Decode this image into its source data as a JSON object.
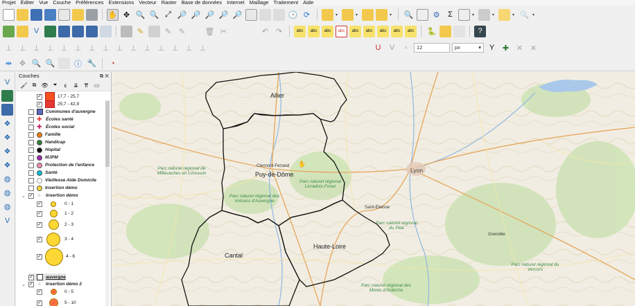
{
  "menu": [
    "Projet",
    "Éditer",
    "Vue",
    "Couche",
    "Préférences",
    "Extensions",
    "Vecteur",
    "Raster",
    "Base de données",
    "Internet",
    "Maillage",
    "Traitement",
    "Aide"
  ],
  "toolbar": {
    "size_value": "12",
    "unit_value": "px"
  },
  "panel": {
    "title": "Couches",
    "controls": "⧉ ✕"
  },
  "layers": [
    {
      "label": "17,7 - 25,7",
      "checked": true,
      "indent": 1,
      "symbol": "square",
      "color": "#f4511e"
    },
    {
      "label": "25,7 - 42,9",
      "checked": true,
      "indent": 1,
      "symbol": "square",
      "color": "#e53935"
    },
    {
      "label": "Communes d'auvergne",
      "checked": false,
      "indent": 0,
      "symbol": "grid",
      "color": "#5c6bc0"
    },
    {
      "label": "Écoles santé",
      "checked": false,
      "indent": 0,
      "symbol": "cross",
      "color": "#e53935"
    },
    {
      "label": "Écoles social",
      "checked": false,
      "indent": 0,
      "symbol": "cross",
      "color": "#c2185b"
    },
    {
      "label": "Famille",
      "checked": false,
      "indent": 0,
      "symbol": "dot",
      "color": "#f57c00"
    },
    {
      "label": "Handicap",
      "checked": false,
      "indent": 0,
      "symbol": "dot",
      "color": "#2e7d32"
    },
    {
      "label": "Hopital",
      "checked": false,
      "indent": 0,
      "symbol": "dot",
      "color": "#111111"
    },
    {
      "label": "MJPM",
      "checked": false,
      "indent": 0,
      "symbol": "dot",
      "color": "#9c27b0"
    },
    {
      "label": "Protection de l'enfance",
      "checked": false,
      "indent": 0,
      "symbol": "dot",
      "color": "#f48fb1"
    },
    {
      "label": "Santé",
      "checked": false,
      "indent": 0,
      "symbol": "dot",
      "color": "#00bcd4"
    },
    {
      "label": "Vieillesse Aide Domicile",
      "checked": false,
      "indent": 0,
      "symbol": "ring",
      "color": "#9e9e9e"
    },
    {
      "label": "Insertion démo",
      "checked": false,
      "indent": 0,
      "symbol": "dot",
      "color": "#fdd835"
    },
    {
      "label": "Insertion démo",
      "checked": true,
      "indent": 0,
      "symbol": "group",
      "color": "#555555"
    },
    {
      "label": "0 - 1",
      "checked": true,
      "indent": 2,
      "symbol": "circle",
      "color": "#fdd835",
      "size": 8
    },
    {
      "label": "1 - 2",
      "checked": true,
      "indent": 2,
      "symbol": "circle",
      "color": "#fdd835",
      "size": 11
    },
    {
      "label": "2 - 3",
      "checked": true,
      "indent": 2,
      "symbol": "circle",
      "color": "#fdd835",
      "size": 15
    },
    {
      "label": "3 - 4",
      "checked": true,
      "indent": 2,
      "symbol": "circle",
      "color": "#fdd835",
      "size": 20
    },
    {
      "label": "4 - 6",
      "checked": true,
      "indent": 2,
      "symbol": "circle",
      "color": "#fdd835",
      "size": 26
    },
    {
      "label": "auvergne",
      "checked": true,
      "indent": 0,
      "symbol": "polygon",
      "color": "#ffffff"
    },
    {
      "label": "Insertion démo 2",
      "checked": true,
      "indent": 0,
      "symbol": "group",
      "color": "#555555"
    },
    {
      "label": "0 - 5",
      "checked": true,
      "indent": 2,
      "symbol": "circle",
      "color": "#ff7043",
      "size": 9
    },
    {
      "label": "5 - 10",
      "checked": true,
      "indent": 2,
      "symbol": "circle",
      "color": "#ff7043",
      "size": 13
    }
  ],
  "map": {
    "departments": [
      "Allier",
      "Puy-de-Dôme",
      "Cantal",
      "Haute-Loire"
    ],
    "cities": [
      "Lyon",
      "Saint-Étienne",
      "Clermont-Ferrand",
      "Grenoble"
    ],
    "parks": [
      "Parc naturel régional des Volcans d'Auvergne",
      "Parc naturel régional Livradois-Forez",
      "Parc naturel régional de Millevaches en Limousin",
      "Parc naturel régional du Pilat",
      "Parc naturel régional des Monts d'Ardèche",
      "Parc naturel régional du Vercors"
    ]
  }
}
